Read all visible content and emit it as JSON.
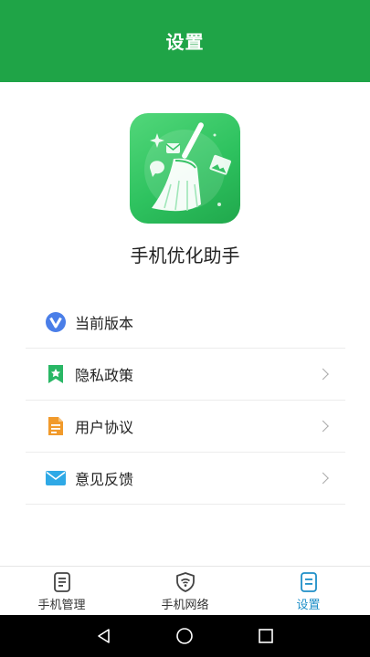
{
  "header": {
    "title": "设置"
  },
  "app": {
    "name": "手机优化助手",
    "icon": "broom-cleaner-icon"
  },
  "menu": {
    "items": [
      {
        "label": "当前版本",
        "icon": "version-v-icon",
        "color": "#4a7ee8",
        "chevron": false
      },
      {
        "label": "隐私政策",
        "icon": "bookmark-star-icon",
        "color": "#29b765",
        "chevron": true
      },
      {
        "label": "用户协议",
        "icon": "document-icon",
        "color": "#f19a2b",
        "chevron": true
      },
      {
        "label": "意见反馈",
        "icon": "mail-icon",
        "color": "#2fa9e6",
        "chevron": true
      }
    ]
  },
  "tabs": [
    {
      "label": "手机管理",
      "icon": "phone-manage-icon",
      "active": false
    },
    {
      "label": "手机网络",
      "icon": "wifi-shield-icon",
      "active": false
    },
    {
      "label": "设置",
      "icon": "settings-doc-icon",
      "active": true
    }
  ],
  "colors": {
    "brand": "#1fa447",
    "active_tab": "#1e8fc8"
  }
}
